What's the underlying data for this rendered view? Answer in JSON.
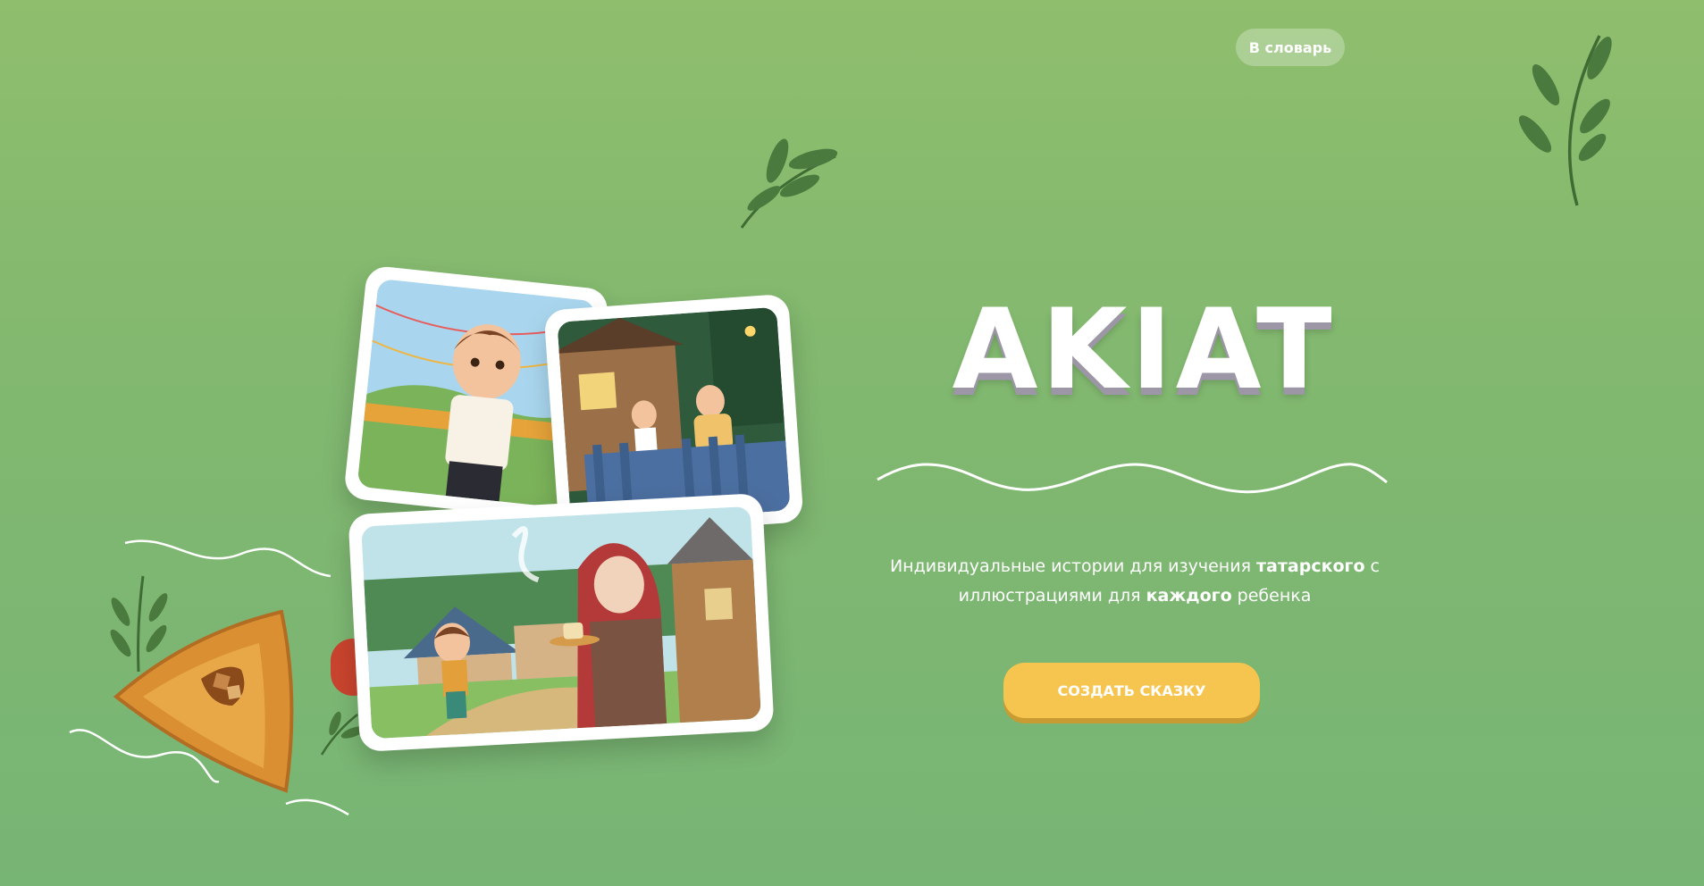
{
  "nav": {
    "dictionary_label": "В словарь"
  },
  "hero": {
    "logo_text": "AKIAT",
    "tagline": {
      "part1": "Индивидуальные истории для изучения ",
      "bold1": "татарского",
      "part2": " с",
      "part3": "иллюстрациями для ",
      "bold2": "каждого",
      "part4": " ребенка"
    },
    "cta_label": "СОЗДАТЬ СКАЗКУ"
  },
  "icons": [
    "leaf-branch-icon",
    "leaf-branch-icon",
    "echpochmak-pastry-icon",
    "wave-decoration-icon"
  ],
  "colors": {
    "background": "#86ba6f",
    "cta": "#f6c54f",
    "leaf": "#3f6b34",
    "text": "#ffffff"
  }
}
